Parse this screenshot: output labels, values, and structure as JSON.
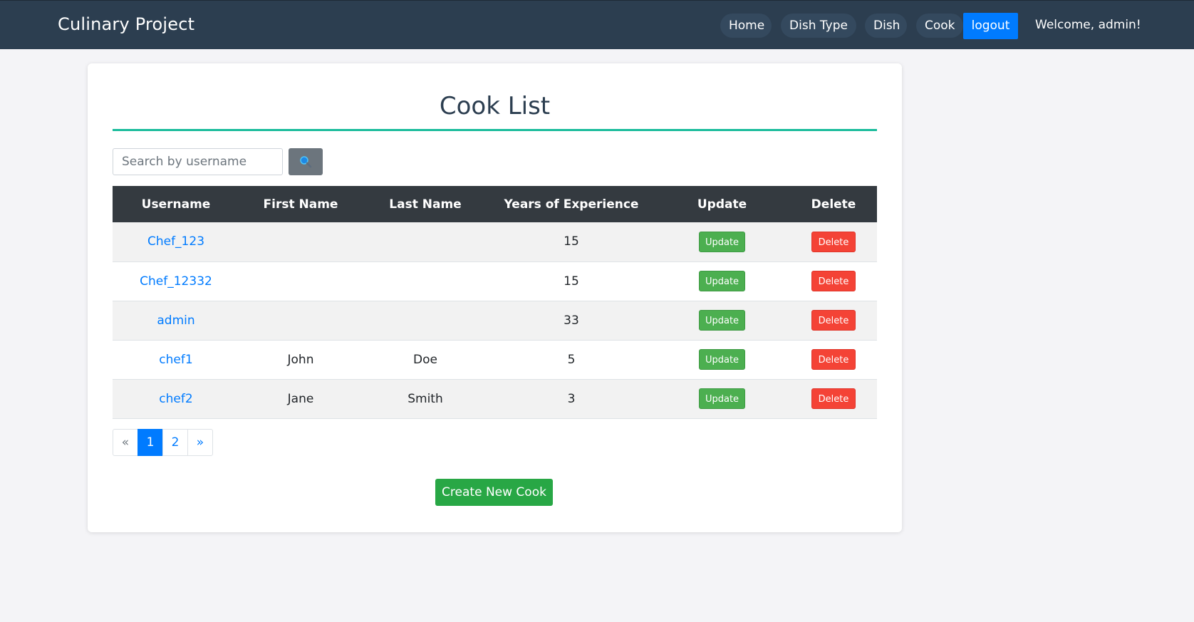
{
  "navbar": {
    "brand": "Culinary Project",
    "links": [
      "Home",
      "Dish Type",
      "Dish",
      "Cook"
    ],
    "logout_label": "logout",
    "welcome": "Welcome, admin!"
  },
  "main": {
    "title": "Cook List",
    "search": {
      "placeholder": "Search by username",
      "value": "",
      "button_icon": "search-icon"
    },
    "table": {
      "headers": [
        "Username",
        "First Name",
        "Last Name",
        "Years of Experience",
        "Update",
        "Delete"
      ],
      "rows": [
        {
          "username": "Chef_123",
          "first_name": "",
          "last_name": "",
          "years": "15",
          "update": "Update",
          "delete": "Delete"
        },
        {
          "username": "Chef_12332",
          "first_name": "",
          "last_name": "",
          "years": "15",
          "update": "Update",
          "delete": "Delete"
        },
        {
          "username": "admin",
          "first_name": "",
          "last_name": "",
          "years": "33",
          "update": "Update",
          "delete": "Delete"
        },
        {
          "username": "chef1",
          "first_name": "John",
          "last_name": "Doe",
          "years": "5",
          "update": "Update",
          "delete": "Delete"
        },
        {
          "username": "chef2",
          "first_name": "Jane",
          "last_name": "Smith",
          "years": "3",
          "update": "Update",
          "delete": "Delete"
        }
      ]
    },
    "pagination": {
      "prev": "«",
      "pages": [
        "1",
        "2"
      ],
      "current": "1",
      "next": "»"
    },
    "create_label": "Create New Cook"
  },
  "colors": {
    "navbar_bg": "#2c3e50",
    "accent": "#1abc9c",
    "primary": "#007bff",
    "update": "#4caf50",
    "delete": "#f44336",
    "create": "#28a745"
  }
}
